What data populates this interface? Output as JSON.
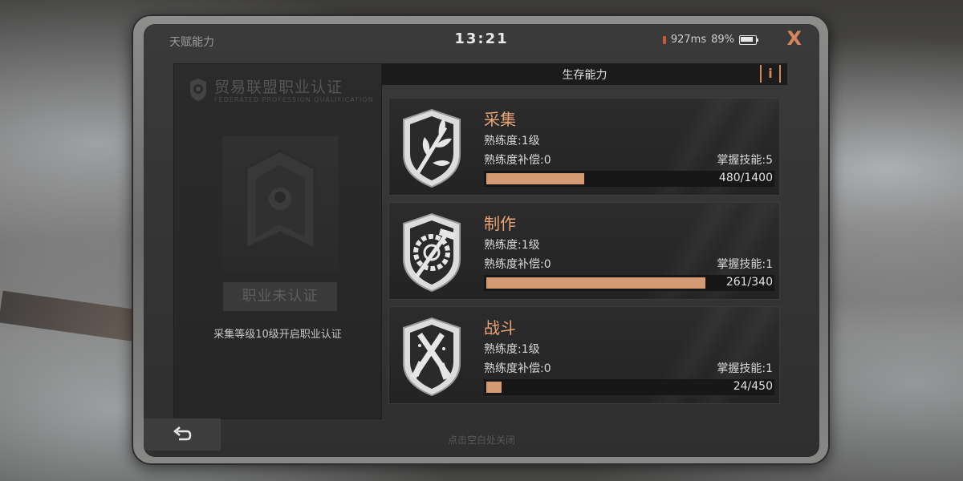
{
  "window": {
    "title": "天赋能力",
    "time": "13:21",
    "ping": "927ms",
    "battery": "89%",
    "close_label": "X"
  },
  "certification": {
    "title": "贸易联盟职业认证",
    "subtitle": "FEDERATED PROFESSION QUALIFICATION",
    "status": "职业未认证",
    "hint": "采集等级10级开启职业认证"
  },
  "section": {
    "title": "生存能力",
    "info_label": "i"
  },
  "skills": [
    {
      "name": "采集",
      "icon": "leaf-shield-icon",
      "level": "熟练度:1级",
      "compensation": "熟练度补偿:0",
      "mastery": "掌握技能:5",
      "progress_text": "480/1400",
      "progress": 0.343
    },
    {
      "name": "制作",
      "icon": "gear-hammer-shield-icon",
      "level": "熟练度:1级",
      "compensation": "熟练度补偿:0",
      "mastery": "掌握技能:1",
      "progress_text": "261/340",
      "progress": 0.768
    },
    {
      "name": "战斗",
      "icon": "guns-shield-icon",
      "level": "熟练度:1级",
      "compensation": "熟练度补偿:0",
      "mastery": "掌握技能:1",
      "progress_text": "24/450",
      "progress": 0.053
    }
  ],
  "footer": {
    "hint": "点击空白处关闭",
    "back_icon": "back-arrow-icon"
  },
  "colors": {
    "accent": "#d7865a",
    "skill_name": "#e8a477",
    "progress_fill": "#d49a74"
  }
}
